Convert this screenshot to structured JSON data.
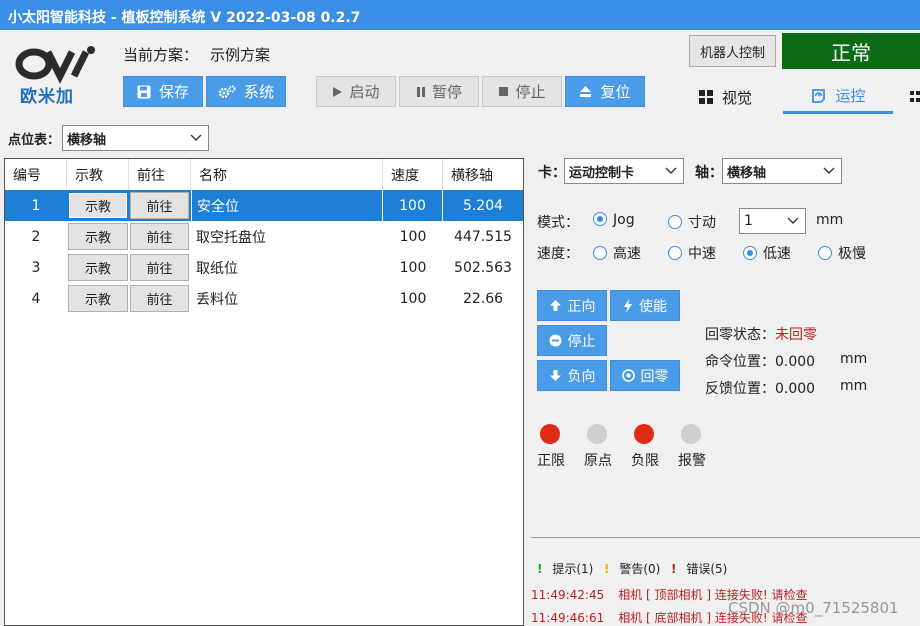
{
  "window": {
    "title": "小太阳智能科技 - 植板控制系统  V 2022-03-08 0.2.7"
  },
  "header": {
    "logo_text": "欧米加",
    "scheme_label": "当前方案：",
    "scheme_value": "示例方案",
    "buttons": {
      "save": "保存",
      "system": "系统",
      "start": "启动",
      "pause": "暂停",
      "stop": "停止",
      "reset": "复位"
    },
    "robot_control": "机器人控制",
    "status": "正常",
    "tabs": {
      "vision": "视觉",
      "motion": "运控"
    },
    "colors": {
      "status_bg": "#0a6b14",
      "accent": "#3a8ee6"
    }
  },
  "point_table": {
    "label": "点位表：",
    "selected": "横移轴",
    "columns": [
      "编号",
      "示教",
      "前往",
      "名称",
      "速度",
      "横移轴"
    ],
    "teach_label": "示教",
    "goto_label": "前往",
    "rows": [
      {
        "id": "1",
        "name": "安全位",
        "speed": "100",
        "axis": "5.204"
      },
      {
        "id": "2",
        "name": "取空托盘位",
        "speed": "100",
        "axis": "447.515"
      },
      {
        "id": "3",
        "name": "取纸位",
        "speed": "100",
        "axis": "502.563"
      },
      {
        "id": "4",
        "name": "丢料位",
        "speed": "100",
        "axis": "22.66"
      }
    ]
  },
  "motion": {
    "card_label": "卡：",
    "card_value": "运动控制卡",
    "axis_label": "轴：",
    "axis_value": "横移轴",
    "mode_label": "模式：",
    "mode_jog": "Jog",
    "mode_inch": "寸动",
    "step_value": "1",
    "step_unit": "mm",
    "speed_label": "速度：",
    "speed_options": [
      "高速",
      "中速",
      "低速",
      "极慢"
    ],
    "speed_selected": "低速",
    "buttons": {
      "forward": "正向",
      "enable": "使能",
      "stop": "停止",
      "backward": "负向",
      "home": "回零"
    },
    "home_status_label": "回零状态：",
    "home_status_value": "未回零",
    "cmd_pos_label": "命令位置：",
    "cmd_pos_value": "0.000",
    "fb_pos_label": "反馈位置：",
    "fb_pos_value": "0.000",
    "unit": "mm",
    "indicators": [
      {
        "label": "正限",
        "color": "#e02b14"
      },
      {
        "label": "原点",
        "color": "#cfcfcf"
      },
      {
        "label": "负限",
        "color": "#e02b14"
      },
      {
        "label": "报警",
        "color": "#cfcfcf"
      }
    ]
  },
  "log": {
    "filters": {
      "info": "提示(1)",
      "warn": "警告(0)",
      "error": "错误(5)"
    },
    "entries": [
      {
        "time": "11:49:42:45",
        "text": "相机 [ 顶部相机 ] 连接失败! 请检查"
      },
      {
        "time": "11:49:46:61",
        "text": "相机 [ 底部相机 ] 连接失败! 请检查"
      }
    ]
  },
  "watermark": "CSDN @m0_71525801"
}
